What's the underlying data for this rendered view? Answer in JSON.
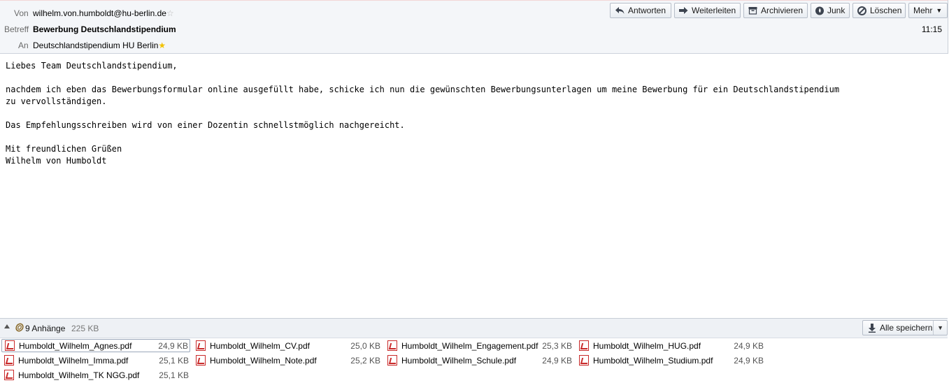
{
  "header": {
    "from_label": "Von",
    "from_value": "wilhelm.von.humboldt@hu-berlin.de",
    "subject_label": "Betreff",
    "subject_value": "Bewerbung Deutschlandstipendium",
    "to_label": "An",
    "to_value": "Deutschlandstipendium HU Berlin",
    "time": "11:15"
  },
  "toolbar": {
    "reply": "Antworten",
    "forward": "Weiterleiten",
    "archive": "Archivieren",
    "junk": "Junk",
    "delete": "Löschen",
    "more": "Mehr"
  },
  "message": {
    "greeting": "Liebes Team Deutschlandstipendium,",
    "para1": "nachdem ich eben das Bewerbungsformular online ausgefüllt habe, schicke ich nun die gewünschten Bewerbungsunterlagen um meine Bewerbung für ein Deutschlandstipendium\nzu vervollständigen.",
    "para2": "Das Empfehlungsschreiben wird von einer Dozentin schnellstmöglich nachgereicht.",
    "closing": "Mit freundlichen Grüßen",
    "signature": "Wilhelm von Humboldt"
  },
  "attachments_bar": {
    "count_label": "9 Anhänge",
    "total_size": "225 KB",
    "save_all": "Alle speichern"
  },
  "attachments": [
    {
      "name": "Humboldt_Wilhelm_Agnes.pdf",
      "size": "24,9 KB"
    },
    {
      "name": "Humboldt_Wilhelm_CV.pdf",
      "size": "25,0 KB"
    },
    {
      "name": "Humboldt_Wilhelm_Engagement.pdf",
      "size": "25,3 KB"
    },
    {
      "name": "Humboldt_Wilhelm_HUG.pdf",
      "size": "24,9 KB"
    },
    {
      "name": "Humboldt_Wilhelm_Imma.pdf",
      "size": "25,1 KB"
    },
    {
      "name": "Humboldt_Wilhelm_Note.pdf",
      "size": "25,2 KB"
    },
    {
      "name": "Humboldt_Wilhelm_Schule.pdf",
      "size": "24,9 KB"
    },
    {
      "name": "Humboldt_Wilhelm_Studium.pdf",
      "size": "24,9 KB"
    },
    {
      "name": "Humboldt_Wilhelm_TK NGG.pdf",
      "size": "25,1 KB"
    }
  ],
  "colors": {
    "header_bg": "#f4f6f9",
    "pdf_icon": "#c92a2a",
    "star_gold": "#f2c200"
  },
  "icons": {
    "reply": "reply-arrow-icon",
    "forward": "forward-arrow-icon",
    "archive": "archive-box-icon",
    "junk": "junk-flame-icon",
    "delete": "delete-circle-icon",
    "attachment": "paperclip-icon",
    "save": "download-arrow-icon",
    "file": "pdf-file-icon"
  }
}
